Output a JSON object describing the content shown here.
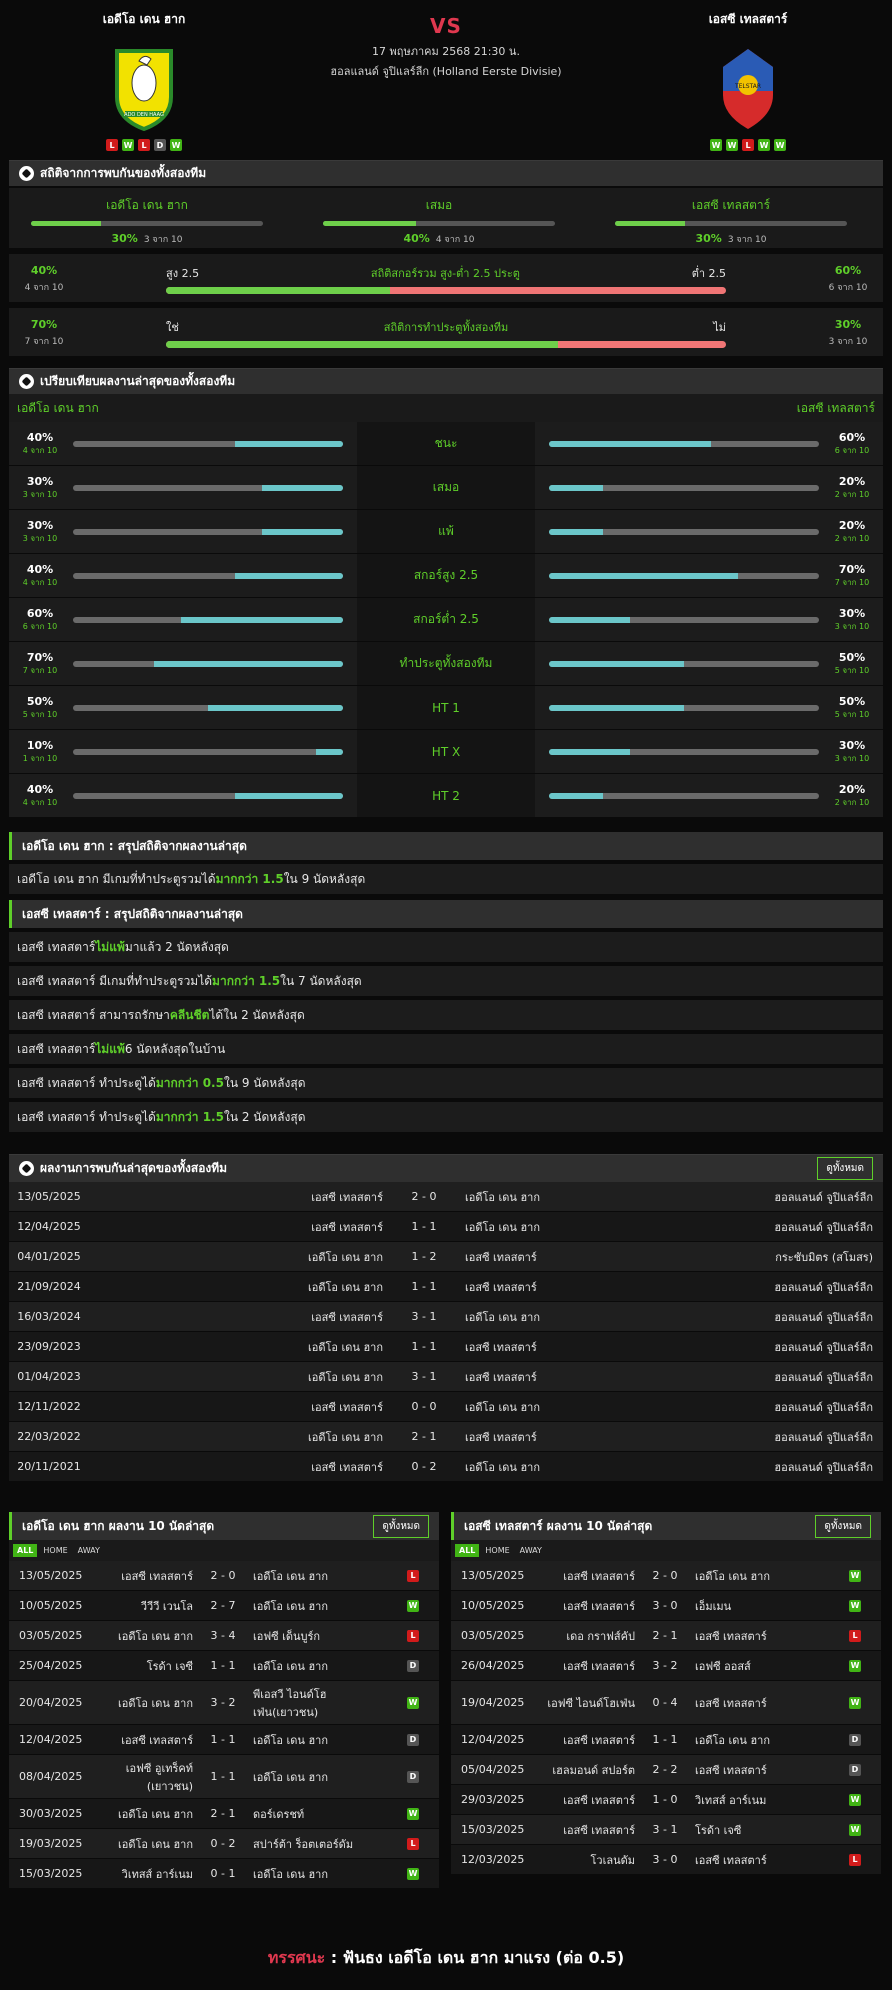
{
  "match": {
    "home": "เอดีโอ เดน ฮาก",
    "away": "เอสซี เทลสตาร์",
    "vs": "VS",
    "datetime": "17 พฤษภาคม 2568 21:30 น.",
    "league": "ฮอลแลนด์ จูปิแลร์ลีก (Holland Eerste Divisie)",
    "home_form": [
      "L",
      "W",
      "L",
      "D",
      "W"
    ],
    "away_form": [
      "W",
      "W",
      "L",
      "W",
      "W"
    ],
    "home_logo_text": "ADO DEN HAAG",
    "away_logo_text": "TELSTAR"
  },
  "h2h": {
    "title": "สถิติจากการพบกันของทั้งสองทีม",
    "cols": [
      {
        "label": "เอดีโอ เดน ฮาก",
        "pct": "30%",
        "of": "3 จาก 10",
        "v": 0.3
      },
      {
        "label": "เสมอ",
        "pct": "40%",
        "of": "4 จาก 10",
        "v": 0.4
      },
      {
        "label": "เอสซี เทลสตาร์",
        "pct": "30%",
        "of": "3 จาก 10",
        "v": 0.3
      }
    ],
    "ou": {
      "title": "สถิติสกอร์รวม สูง-ต่ำ 2.5 ประตู",
      "left_label": "สูง 2.5",
      "right_label": "ต่ำ 2.5",
      "lp": "40%",
      "ls": "4 จาก 10",
      "rp": "60%",
      "rs": "6 จาก 10",
      "v": 0.4
    },
    "btts": {
      "title": "สถิติการทำประตูทั้งสองทีม",
      "left_label": "ใช่",
      "right_label": "ไม่",
      "lp": "70%",
      "ls": "7 จาก 10",
      "rp": "30%",
      "rs": "3 จาก 10",
      "v": 0.7
    }
  },
  "compare": {
    "title": "เปรียบเทียบผลงานล่าสุดของทั้งสองทีม",
    "home": "เอดีโอ เดน ฮาก",
    "away": "เอสซี เทลสตาร์",
    "rows": [
      {
        "label": "ชนะ",
        "hp": "40%",
        "hs": "4 จาก 10",
        "hv": 0.4,
        "ap": "60%",
        "as": "6 จาก 10",
        "av": 0.6
      },
      {
        "label": "เสมอ",
        "hp": "30%",
        "hs": "3 จาก 10",
        "hv": 0.3,
        "ap": "20%",
        "as": "2 จาก 10",
        "av": 0.2
      },
      {
        "label": "แพ้",
        "hp": "30%",
        "hs": "3 จาก 10",
        "hv": 0.3,
        "ap": "20%",
        "as": "2 จาก 10",
        "av": 0.2
      },
      {
        "label": "สกอร์สูง 2.5",
        "hp": "40%",
        "hs": "4 จาก 10",
        "hv": 0.4,
        "ap": "70%",
        "as": "7 จาก 10",
        "av": 0.7
      },
      {
        "label": "สกอร์ต่ำ 2.5",
        "hp": "60%",
        "hs": "6 จาก 10",
        "hv": 0.6,
        "ap": "30%",
        "as": "3 จาก 10",
        "av": 0.3
      },
      {
        "label": "ทำประตูทั้งสองทีม",
        "hp": "70%",
        "hs": "7 จาก 10",
        "hv": 0.7,
        "ap": "50%",
        "as": "5 จาก 10",
        "av": 0.5
      },
      {
        "label": "HT 1",
        "hp": "50%",
        "hs": "5 จาก 10",
        "hv": 0.5,
        "ap": "50%",
        "as": "5 จาก 10",
        "av": 0.5
      },
      {
        "label": "HT X",
        "hp": "10%",
        "hs": "1 จาก 10",
        "hv": 0.1,
        "ap": "30%",
        "as": "3 จาก 10",
        "av": 0.3
      },
      {
        "label": "HT 2",
        "hp": "40%",
        "hs": "4 จาก 10",
        "hv": 0.4,
        "ap": "20%",
        "as": "2 จาก 10",
        "av": 0.2
      }
    ]
  },
  "summary_home": {
    "title": "เอดีโอ เดน ฮาก : สรุปสถิติจากผลงานล่าสุด",
    "rows": [
      {
        "pre": "เอดีโอ เดน ฮาก  มีเกมที่ทำประตูรวมได้ ",
        "key": "มากกว่า 1.5",
        "post": " ใน 9 นัดหลังสุด"
      }
    ]
  },
  "summary_away": {
    "title": "เอสซี เทลสตาร์ : สรุปสถิติจากผลงานล่าสุด",
    "rows": [
      {
        "pre": "เอสซี เทลสตาร์ ",
        "key": "ไม่แพ้",
        "post": " มาแล้ว 2 นัดหลังสุด"
      },
      {
        "pre": "เอสซี เทลสตาร์  มีเกมที่ทำประตูรวมได้ ",
        "key": "มากกว่า 1.5",
        "post": " ใน 7 นัดหลังสุด"
      },
      {
        "pre": "เอสซี เทลสตาร์  สามารถรักษา ",
        "key": "คลีนชีต",
        "post": " ได้ใน 2 นัดหลังสุด"
      },
      {
        "pre": "เอสซี เทลสตาร์ ",
        "key": "ไม่แพ้",
        "post": " 6  นัดหลังสุดในบ้าน"
      },
      {
        "pre": "เอสซี เทลสตาร์  ทำประตูได้ ",
        "key": "มากกว่า 0.5",
        "post": " ใน 9 นัดหลังสุด"
      },
      {
        "pre": "เอสซี เทลสตาร์  ทำประตูได้ ",
        "key": "มากกว่า 1.5",
        "post": " ใน 2 นัดหลังสุด"
      }
    ]
  },
  "meetings": {
    "title": "ผลงานการพบกันล่าสุดของทั้งสองทีม",
    "all": "ดูทั้งหมด",
    "rows": [
      [
        "13/05/2025",
        "เอสซี เทลสตาร์",
        "2 - 0",
        "เอดีโอ เดน ฮาก",
        "ฮอลแลนด์ จูปิแลร์ลีก"
      ],
      [
        "12/04/2025",
        "เอสซี เทลสตาร์",
        "1 - 1",
        "เอดีโอ เดน ฮาก",
        "ฮอลแลนด์ จูปิแลร์ลีก"
      ],
      [
        "04/01/2025",
        "เอดีโอ เดน ฮาก",
        "1 - 2",
        "เอสซี เทลสตาร์",
        "กระชับมิตร (สโมสร)"
      ],
      [
        "21/09/2024",
        "เอดีโอ เดน ฮาก",
        "1 - 1",
        "เอสซี เทลสตาร์",
        "ฮอลแลนด์ จูปิแลร์ลีก"
      ],
      [
        "16/03/2024",
        "เอสซี เทลสตาร์",
        "3 - 1",
        "เอดีโอ เดน ฮาก",
        "ฮอลแลนด์ จูปิแลร์ลีก"
      ],
      [
        "23/09/2023",
        "เอดีโอ เดน ฮาก",
        "1 - 1",
        "เอสซี เทลสตาร์",
        "ฮอลแลนด์ จูปิแลร์ลีก"
      ],
      [
        "01/04/2023",
        "เอดีโอ เดน ฮาก",
        "3 - 1",
        "เอสซี เทลสตาร์",
        "ฮอลแลนด์ จูปิแลร์ลีก"
      ],
      [
        "12/11/2022",
        "เอสซี เทลสตาร์",
        "0 - 0",
        "เอดีโอ เดน ฮาก",
        "ฮอลแลนด์ จูปิแลร์ลีก"
      ],
      [
        "22/03/2022",
        "เอดีโอ เดน ฮาก",
        "2 - 1",
        "เอสซี เทลสตาร์",
        "ฮอลแลนด์ จูปิแลร์ลีก"
      ],
      [
        "20/11/2021",
        "เอสซี เทลสตาร์",
        "0 - 2",
        "เอดีโอ เดน ฮาก",
        "ฮอลแลนด์ จูปิแลร์ลีก"
      ]
    ]
  },
  "last_home": {
    "title": "เอดีโอ เดน ฮาก ผลงาน 10 นัดล่าสุด",
    "all": "ดูทั้งหมด",
    "tabs": [
      "ALL",
      "HOME",
      "AWAY"
    ],
    "rows": [
      [
        "13/05/2025",
        "เอสซี เทลสตาร์",
        "2 - 0",
        "เอดีโอ เดน ฮาก",
        "L"
      ],
      [
        "10/05/2025",
        "วีวีวี เวนโล",
        "2 - 7",
        "เอดีโอ เดน ฮาก",
        "W"
      ],
      [
        "03/05/2025",
        "เอดีโอ เดน ฮาก",
        "3 - 4",
        "เอฟซี เด็นบูร์ก",
        "L"
      ],
      [
        "25/04/2025",
        "โรด้า เจซี",
        "1 - 1",
        "เอดีโอ เดน ฮาก",
        "D"
      ],
      [
        "20/04/2025",
        "เอดีโอ เดน ฮาก",
        "3 - 2",
        "พีเอสวี ไอนด์โฮเฟ่น(เยาวชน)",
        "W"
      ],
      [
        "12/04/2025",
        "เอสซี เทลสตาร์",
        "1 - 1",
        "เอดีโอ เดน ฮาก",
        "D"
      ],
      [
        "08/04/2025",
        "เอฟซี อูเทร็คท์ (เยาวชน)",
        "1 - 1",
        "เอดีโอ เดน ฮาก",
        "D"
      ],
      [
        "30/03/2025",
        "เอดีโอ เดน ฮาก",
        "2 - 1",
        "ดอร์เดรชท์",
        "W"
      ],
      [
        "19/03/2025",
        "เอดีโอ เดน ฮาก",
        "0 - 2",
        "สปาร์ต้า ร็อตเตอร์ดัม",
        "L"
      ],
      [
        "15/03/2025",
        "วิเทสส์ อาร์เนม",
        "0 - 1",
        "เอดีโอ เดน ฮาก",
        "W"
      ]
    ]
  },
  "last_away": {
    "title": "เอสซี เทลสตาร์ ผลงาน 10 นัดล่าสุด",
    "all": "ดูทั้งหมด",
    "tabs": [
      "ALL",
      "HOME",
      "AWAY"
    ],
    "rows": [
      [
        "13/05/2025",
        "เอสซี เทลสตาร์",
        "2 - 0",
        "เอดีโอ เดน ฮาก",
        "W"
      ],
      [
        "10/05/2025",
        "เอสซี เทลสตาร์",
        "3 - 0",
        "เอ็มเมน",
        "W"
      ],
      [
        "03/05/2025",
        "เดอ กราฟส์คัป",
        "2 - 1",
        "เอสซี เทลสตาร์",
        "L"
      ],
      [
        "26/04/2025",
        "เอสซี เทลสตาร์",
        "3 - 2",
        "เอฟซี ออสส์",
        "W"
      ],
      [
        "19/04/2025",
        "เอฟซี ไอนด์โฮเฟ่น",
        "0 - 4",
        "เอสซี เทลสตาร์",
        "W"
      ],
      [
        "12/04/2025",
        "เอสซี เทลสตาร์",
        "1 - 1",
        "เอดีโอ เดน ฮาก",
        "D"
      ],
      [
        "05/04/2025",
        "เฮลมอนด์ สปอร์ต",
        "2 - 2",
        "เอสซี เทลสตาร์",
        "D"
      ],
      [
        "29/03/2025",
        "เอสซี เทลสตาร์",
        "1 - 0",
        "วิเทสส์ อาร์เนม",
        "W"
      ],
      [
        "15/03/2025",
        "เอสซี เทลสตาร์",
        "3 - 1",
        "โรด้า เจซี",
        "W"
      ],
      [
        "12/03/2025",
        "โวเลนดัม",
        "3 - 0",
        "เอสซี เทลสตาร์",
        "L"
      ]
    ]
  },
  "verdict": {
    "label": "ทรรศนะ",
    "sep": " : ",
    "text": "ฟันธง เอดีโอ เดน ฮาก มาแรง (ต่อ 0.5)"
  },
  "colors": {
    "accent": "#5fcf2a",
    "vs": "#e0384f",
    "teal": "#6bc6c9",
    "red": "#f07575"
  }
}
